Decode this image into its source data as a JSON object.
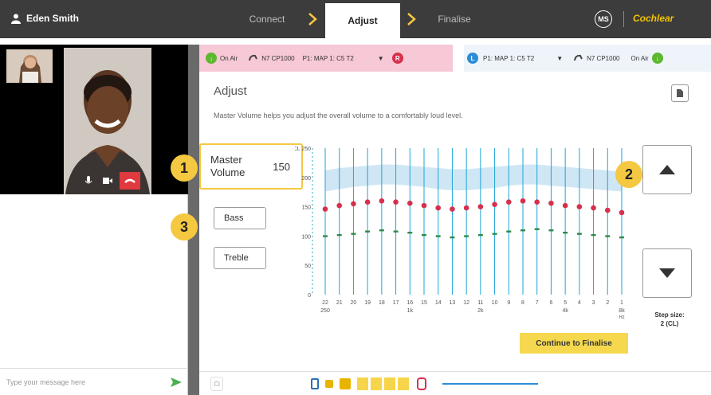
{
  "header": {
    "user_name": "Eden Smith",
    "steps": [
      "Connect",
      "Adjust",
      "Finalise"
    ],
    "active_step": "Adjust",
    "initials": "MS",
    "brand": "Cochlear"
  },
  "processors": {
    "right": {
      "status": "On Air",
      "model": "N7 CP1000",
      "map": "P1: MAP 1: C5 T2",
      "side": "R"
    },
    "left": {
      "status": "On Air",
      "model": "N7 CP1000",
      "map": "P1: MAP 1: C5 T2",
      "side": "L"
    }
  },
  "main": {
    "title": "Adjust",
    "description": "Master Volume helps you adjust the overall volume to a comfortably loud level.",
    "master_volume": {
      "label": "Master Volume",
      "value": "150"
    },
    "bass_label": "Bass",
    "treble_label": "Treble",
    "step_size": "Step size:",
    "step_value": "2 (CL)",
    "continue_label": "Continue to Finalise",
    "badges": [
      "1",
      "2",
      "3"
    ]
  },
  "chat": {
    "placeholder": "Type your message here"
  },
  "chart_data": {
    "type": "scatter",
    "ylabel": "CL",
    "ylim": [
      0,
      250
    ],
    "yticks": [
      0,
      50,
      100,
      150,
      200,
      250
    ],
    "x_electrodes": [
      "22",
      "21",
      "20",
      "19",
      "18",
      "17",
      "16",
      "15",
      "14",
      "13",
      "12",
      "11",
      "10",
      "9",
      "8",
      "7",
      "6",
      "5",
      "4",
      "3",
      "2",
      "1"
    ],
    "freq_labels": [
      {
        "at": "22",
        "text": "250"
      },
      {
        "at": "16",
        "text": "1k"
      },
      {
        "at": "11",
        "text": "2k"
      },
      {
        "at": "5",
        "text": "4k"
      },
      {
        "at": "1",
        "text": "8k"
      }
    ],
    "freq_unit": "Hz",
    "series": [
      {
        "values": [
          146,
          152,
          155,
          158,
          160,
          158,
          156,
          152,
          148,
          146,
          148,
          150,
          154,
          158,
          160,
          158,
          156,
          152,
          150,
          148,
          144,
          140
        ]
      },
      {
        "values": [
          100,
          102,
          104,
          108,
          110,
          108,
          106,
          102,
          100,
          98,
          100,
          102,
          104,
          108,
          110,
          112,
          110,
          106,
          104,
          102,
          100,
          98
        ]
      }
    ],
    "band_upper": [
      212,
      216,
      218,
      220,
      222,
      222,
      220,
      218,
      216,
      214,
      214,
      216,
      218,
      220,
      222,
      222,
      220,
      218,
      216,
      214,
      212,
      210
    ],
    "band_lower": [
      176,
      180,
      184,
      186,
      188,
      188,
      186,
      184,
      180,
      178,
      178,
      180,
      182,
      186,
      188,
      188,
      186,
      184,
      182,
      180,
      178,
      176
    ]
  },
  "colors": {
    "topbar": "#3c3c3c",
    "accent": "#f5c842",
    "red_proc": "#f7c8d6",
    "left_proc": "#eef4fa",
    "red_dot": "#d6304c",
    "green_dot": "#2f8a4c"
  }
}
